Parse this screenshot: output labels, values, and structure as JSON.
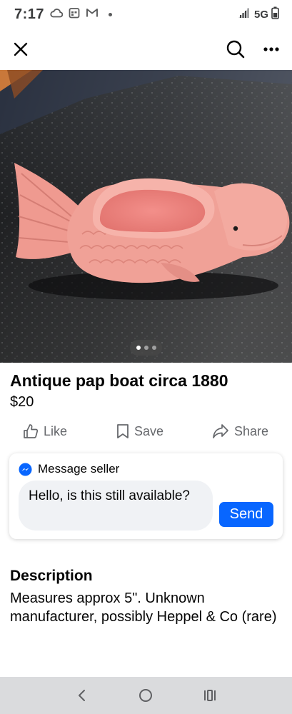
{
  "status_bar": {
    "time": "7:17",
    "network": "5G",
    "icons": [
      "cloud-icon",
      "calendar-icon",
      "gmail-icon",
      "notification-dot",
      "signal-icon",
      "battery-icon"
    ]
  },
  "top_bar": {
    "icons": [
      "close-icon",
      "search-icon",
      "more-options-icon"
    ]
  },
  "photo": {
    "pager_count": 3,
    "pager_active_index": 0
  },
  "listing": {
    "title": "Antique pap boat circa 1880",
    "price": "$20"
  },
  "actions": {
    "like_label": "Like",
    "save_label": "Save",
    "share_label": "Share"
  },
  "message": {
    "header": "Message seller",
    "input_value": "Hello, is this still available?",
    "send_label": "Send"
  },
  "description": {
    "heading": "Description",
    "body": "Measures approx 5\".  Unknown manufacturer, possibly Heppel & Co (rare)"
  },
  "colors": {
    "accent": "#0866ff",
    "secondary_text": "#65676b",
    "bubble_bg": "#f0f2f5",
    "nav_bg": "#dadbdd"
  }
}
